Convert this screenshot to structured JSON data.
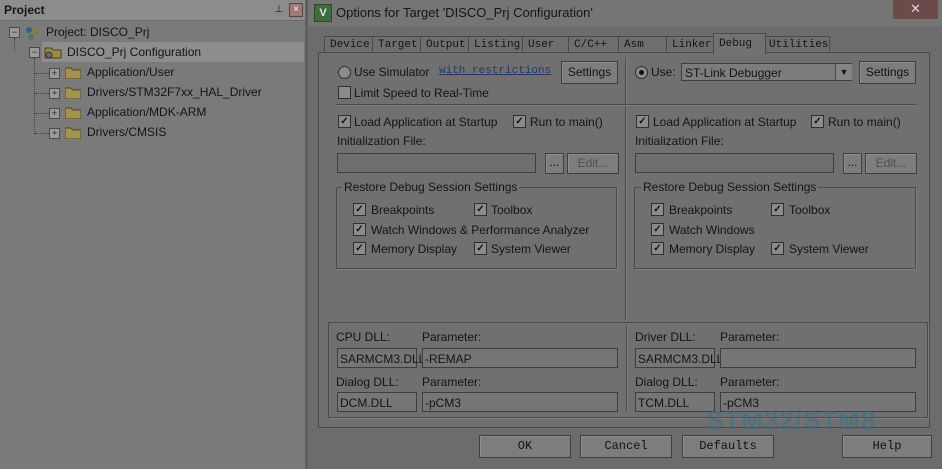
{
  "project_pane": {
    "title": "Project",
    "pin_glyph": "⊥",
    "close_glyph": "×",
    "tree": {
      "root": "Project: DISCO_Prj",
      "target": "DISCO_Prj Configuration",
      "groups": [
        "Application/User",
        "Drivers/STM32F7xx_HAL_Driver",
        "Application/MDK-ARM",
        "Drivers/CMSIS"
      ]
    }
  },
  "dialog": {
    "title": "Options for Target 'DISCO_Prj Configuration'",
    "icon_glyph": "V",
    "close_glyph": "✕",
    "tabs": [
      "Device",
      "Target",
      "Output",
      "Listing",
      "User",
      "C/C++",
      "Asm",
      "Linker",
      "Debug",
      "Utilities"
    ],
    "active_tab": "Debug",
    "left": {
      "use_simulator_label": "Use Simulator",
      "with_restrictions_link": "with restrictions",
      "settings_button": "Settings",
      "limit_speed_label": "Limit Speed to Real-Time",
      "load_app_label": "Load Application at Startup",
      "run_to_main_label": "Run to main()",
      "init_file_label": "Initialization File:",
      "browse_button": "...",
      "edit_button": "Edit...",
      "restore_group_title": "Restore Debug Session Settings",
      "breakpoints_label": "Breakpoints",
      "toolbox_label": "Toolbox",
      "watch_windows_label": "Watch Windows & Performance Analyzer",
      "memory_display_label": "Memory Display",
      "system_viewer_label": "System Viewer"
    },
    "right": {
      "use_label": "Use:",
      "debugger_selected": "ST-Link Debugger",
      "settings_button": "Settings",
      "load_app_label": "Load Application at Startup",
      "run_to_main_label": "Run to main()",
      "init_file_label": "Initialization File:",
      "browse_button": "...",
      "edit_button": "Edit...",
      "restore_group_title": "Restore Debug Session Settings",
      "breakpoints_label": "Breakpoints",
      "toolbox_label": "Toolbox",
      "watch_windows_label": "Watch Windows",
      "memory_display_label": "Memory Display",
      "system_viewer_label": "System Viewer"
    },
    "dll": {
      "cpu_dll_label": "CPU DLL:",
      "cpu_param_label": "Parameter:",
      "cpu_dll_value": "SARMCM3.DLL",
      "cpu_param_value": "-REMAP",
      "dialog_dll_label": "Dialog DLL:",
      "dialog_param_label": "Parameter:",
      "dialog_dll_value": "DCM.DLL",
      "dialog_param_value": "-pCM3",
      "driver_dll_label": "Driver DLL:",
      "driver_param_label": "Parameter:",
      "driver_dll_value": "SARMCM3.DLL",
      "driver_param_value": "",
      "right_dialog_dll_label": "Dialog DLL:",
      "right_dialog_param_label": "Parameter:",
      "right_dialog_dll_value": "TCM.DLL",
      "right_dialog_param_value": "-pCM3"
    },
    "buttons": {
      "ok": "OK",
      "cancel": "Cancel",
      "defaults": "Defaults",
      "help": "Help"
    }
  },
  "watermark": {
    "main": "STM32/STM8",
    "sub": ""
  },
  "check_glyph": "✓",
  "expander_glyph": "+",
  "collapse_glyph": "−",
  "dropdown_glyph": "▼"
}
